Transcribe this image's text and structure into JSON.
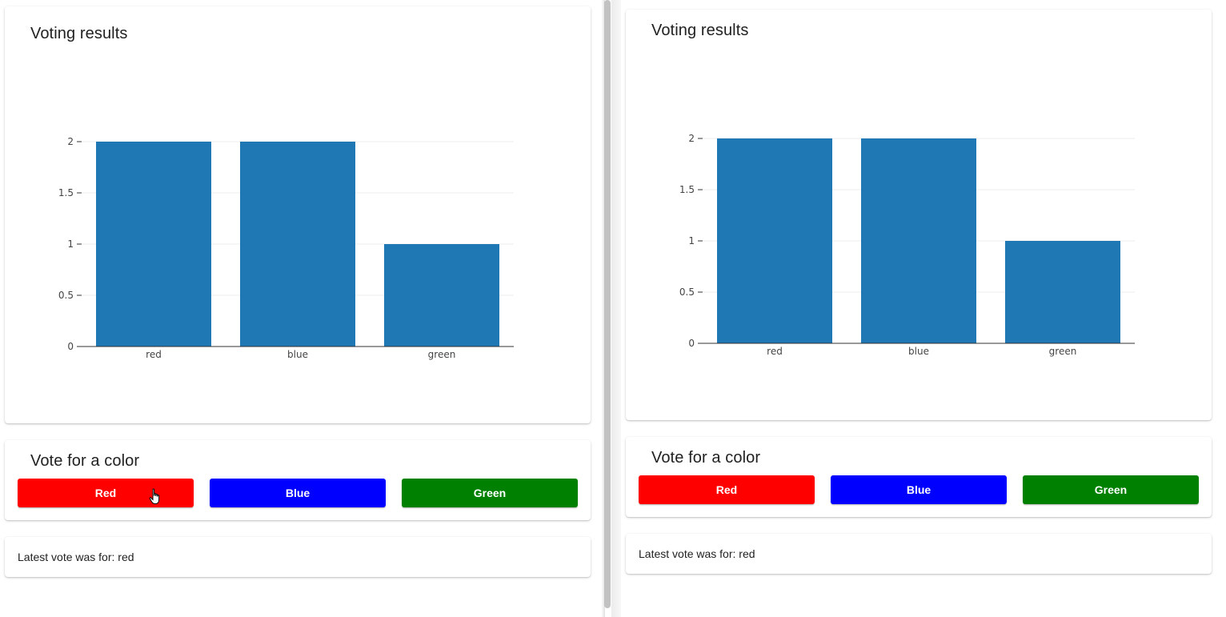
{
  "colors": {
    "bar": "#1f77b4",
    "red_button": "#ff0000",
    "blue_button": "#0000ff",
    "green_button": "#008000"
  },
  "panes": [
    {
      "results_title": "Voting results",
      "vote_title": "Vote for a color",
      "buttons": {
        "red": "Red",
        "blue": "Blue",
        "green": "Green"
      },
      "latest_vote": "Latest vote was for: red"
    },
    {
      "results_title": "Voting results",
      "vote_title": "Vote for a color",
      "buttons": {
        "red": "Red",
        "blue": "Blue",
        "green": "Green"
      },
      "latest_vote": "Latest vote was for: red"
    }
  ],
  "chart_data": [
    {
      "type": "bar",
      "categories": [
        "red",
        "blue",
        "green"
      ],
      "values": [
        2,
        2,
        1
      ],
      "ylim": [
        0,
        2
      ],
      "yticks": [
        "0",
        "0.5",
        "1",
        "1.5",
        "2"
      ],
      "grid": true
    },
    {
      "type": "bar",
      "categories": [
        "red",
        "blue",
        "green"
      ],
      "values": [
        2,
        2,
        1
      ],
      "ylim": [
        0,
        2
      ],
      "yticks": [
        "0",
        "0.5",
        "1",
        "1.5",
        "2"
      ],
      "grid": true
    }
  ],
  "cursor": "hand-pointer-icon"
}
